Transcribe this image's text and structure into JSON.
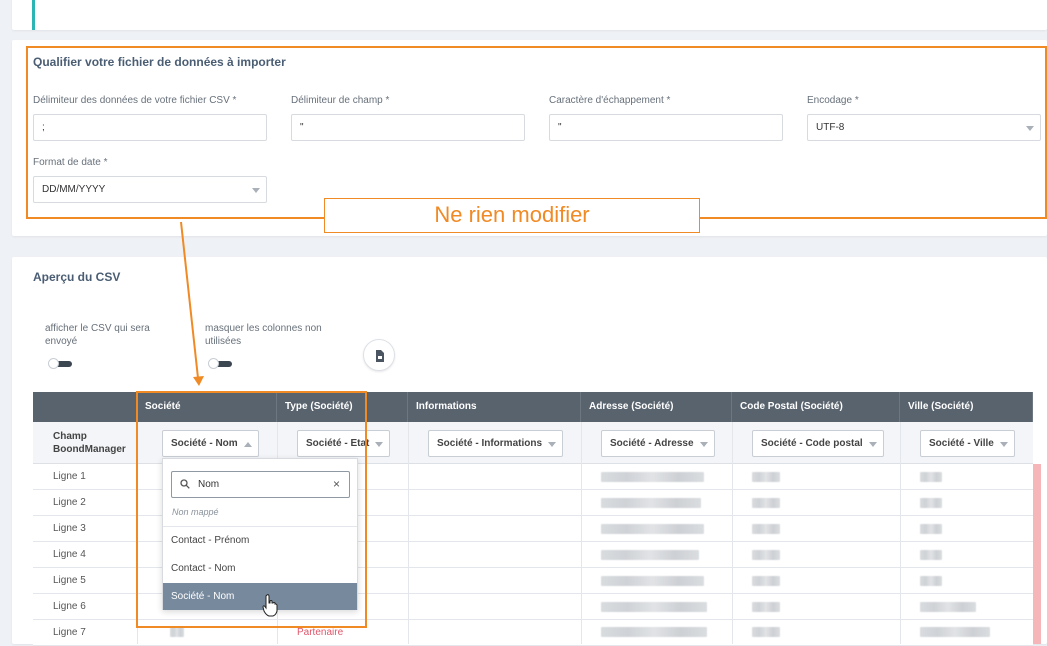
{
  "qualify": {
    "title": "Qualifier votre fichier de données à importer",
    "fields": [
      {
        "label": "Délimiteur des données de votre fichier CSV",
        "required": "*",
        "value": ";"
      },
      {
        "label": "Délimiteur de champ",
        "required": "*",
        "value": "\""
      },
      {
        "label": "Caractère d'échappement",
        "required": "*",
        "value": "\""
      },
      {
        "label": "Encodage",
        "required": "*",
        "value": "UTF-8"
      },
      {
        "label": "Format de date",
        "required": "*",
        "value": "DD/MM/YYYY"
      }
    ]
  },
  "callout": "Ne rien modifier",
  "preview": {
    "title": "Aperçu du CSV",
    "toggle_sent": "afficher le CSV qui sera envoyé",
    "toggle_unused": "masquer les colonnes non utilisées",
    "columns": [
      "Société",
      "Type (Société)",
      "Informations",
      "Adresse (Société)",
      "Code Postal (Société)",
      "Ville (Société)"
    ],
    "mapping_label": "Champ BoondManager",
    "mappings": [
      "Société - Nom",
      "Société - Etat",
      "Société - Informations",
      "Société - Adresse",
      "Société - Code postal",
      "Société - Ville"
    ],
    "rows": [
      "Ligne 1",
      "Ligne 2",
      "Ligne 3",
      "Ligne 4",
      "Ligne 5",
      "Ligne 6",
      "Ligne 7"
    ],
    "row7_type": "Partenaire"
  },
  "dropdown": {
    "search_value": "Nom",
    "unmapped": "Non mappé",
    "options": [
      "Contact - Prénom",
      "Contact - Nom",
      "Société - Nom"
    ],
    "selected": "Société - Nom"
  },
  "colors": {
    "accent_orange": "#f08a24",
    "header_bg": "#59636e",
    "selected_option": "#77899d"
  }
}
